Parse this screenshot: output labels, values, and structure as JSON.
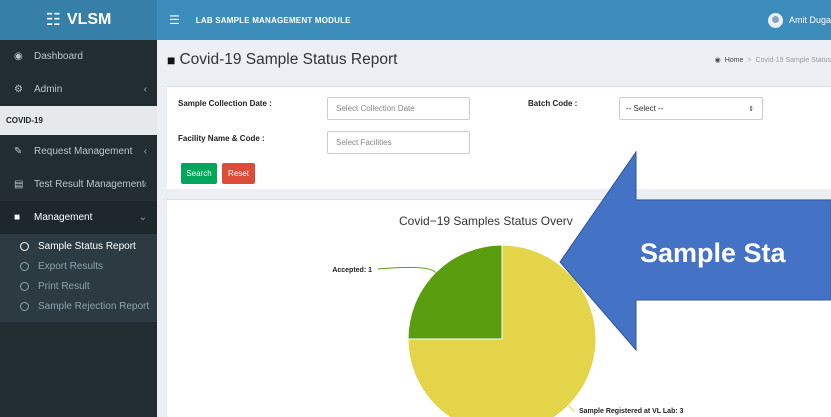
{
  "app": {
    "logo_text": "VLSM",
    "module_title": "LAB SAMPLE MANAGEMENT MODULE",
    "user_name": "Amit Duga"
  },
  "sidebar": {
    "items": [
      {
        "label": "Dashboard",
        "icon": "dashboard-icon"
      },
      {
        "label": "Admin",
        "icon": "cogs-icon"
      }
    ],
    "section_header": "COVID-19",
    "section_items": [
      {
        "label": "Request Management",
        "icon": "edit-icon"
      },
      {
        "label": "Test Result Management",
        "icon": "list-icon"
      },
      {
        "label": "Management",
        "icon": "book-icon"
      }
    ],
    "submenu": [
      {
        "label": "Sample Status Report"
      },
      {
        "label": "Export Results"
      },
      {
        "label": "Print Result"
      },
      {
        "label": "Sample Rejection Report"
      }
    ]
  },
  "header": {
    "page_title": "Covid-19 Sample Status Report",
    "breadcrumb_home": "Home",
    "breadcrumb_current": "Covid-19 Sample Status"
  },
  "filters": {
    "collection_date_label": "Sample Collection Date :",
    "collection_date_placeholder": "Select Collection Date",
    "batch_code_label": "Batch Code :",
    "batch_code_value": "-- Select --",
    "facility_label": "Facility Name & Code :",
    "facility_placeholder": "Select Facilities",
    "search_label": "Search",
    "reset_label": "Reset"
  },
  "overlay": {
    "callout_text": "Sample Sta"
  },
  "colors": {
    "accepted": "#5a9e10",
    "registered": "#e3d44a",
    "callout": "#4472c4"
  },
  "chart_data": {
    "type": "pie",
    "title": "Covid−19 Samples Status Overv",
    "slices": [
      {
        "label": "Accepted",
        "value": 1,
        "data_label": "Accepted: 1"
      },
      {
        "label": "Sample Registered at VL Lab",
        "value": 3,
        "data_label": "Sample Registered at VL Lab: 3"
      }
    ]
  }
}
